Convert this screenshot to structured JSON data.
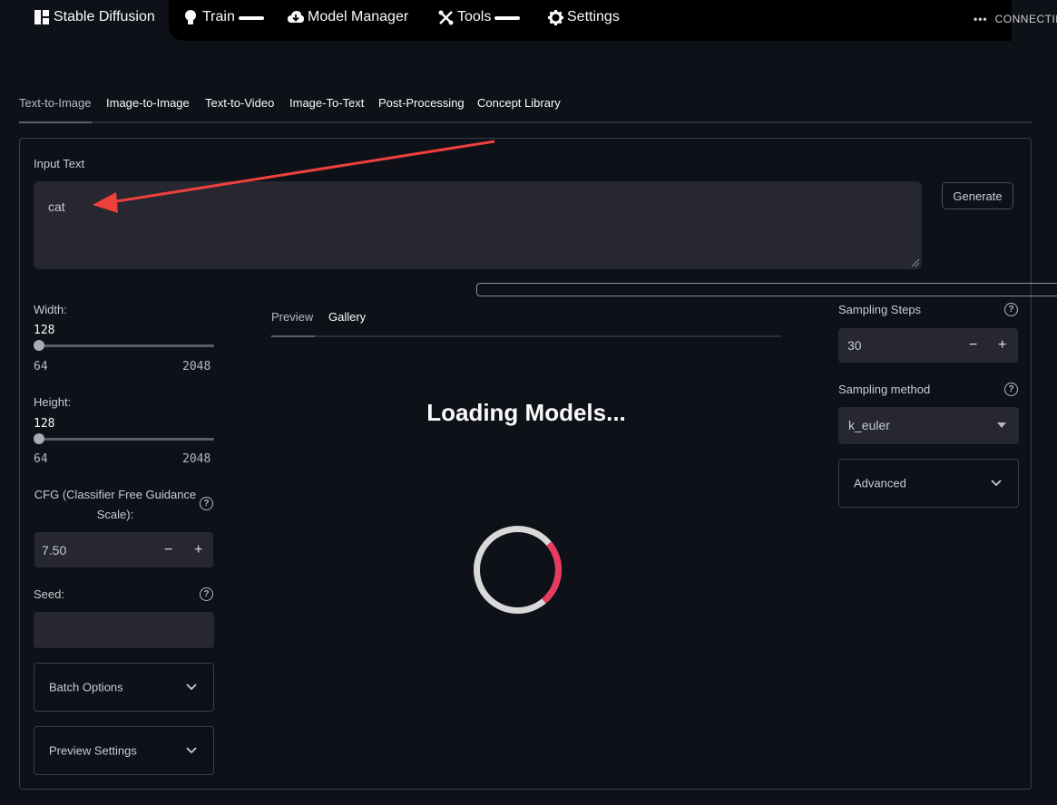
{
  "nav": {
    "items": [
      {
        "label": "Stable Diffusion",
        "icon": "dashboard-icon"
      },
      {
        "label": "Train",
        "icon": "lightbulb-icon"
      },
      {
        "label": "Model Manager",
        "icon": "cloud-download-icon"
      },
      {
        "label": "Tools",
        "icon": "tools-icon"
      },
      {
        "label": "Settings",
        "icon": "gear-icon"
      }
    ],
    "status": "CONNECTING"
  },
  "tabs": [
    "Text-to-Image",
    "Image-to-Image",
    "Text-to-Video",
    "Image-To-Text",
    "Post-Processing",
    "Concept Library"
  ],
  "prompt": {
    "label": "Input Text",
    "value": "cat",
    "generate_label": "Generate"
  },
  "left": {
    "width": {
      "label": "Width:",
      "value": "128",
      "min": "64",
      "max": "2048"
    },
    "height": {
      "label": "Height:",
      "value": "128",
      "min": "64",
      "max": "2048"
    },
    "cfg": {
      "label": "CFG (Classifier Free Guidance Scale):",
      "value": "7.50"
    },
    "seed": {
      "label": "Seed:",
      "value": ""
    },
    "batch_label": "Batch Options",
    "preview_label": "Preview Settings"
  },
  "center": {
    "tabs": [
      "Preview",
      "Gallery"
    ],
    "loading_text": "Loading Models...",
    "spinner_progress": 0.25
  },
  "right": {
    "steps": {
      "label": "Sampling Steps",
      "value": "30"
    },
    "method": {
      "label": "Sampling method",
      "value": "k_euler"
    },
    "advanced_label": "Advanced"
  },
  "colors": {
    "background": "#0e1117",
    "input_bg": "#262730",
    "spinner_accent": "#ea3a5f",
    "annotation_arrow": "#f0403c"
  }
}
